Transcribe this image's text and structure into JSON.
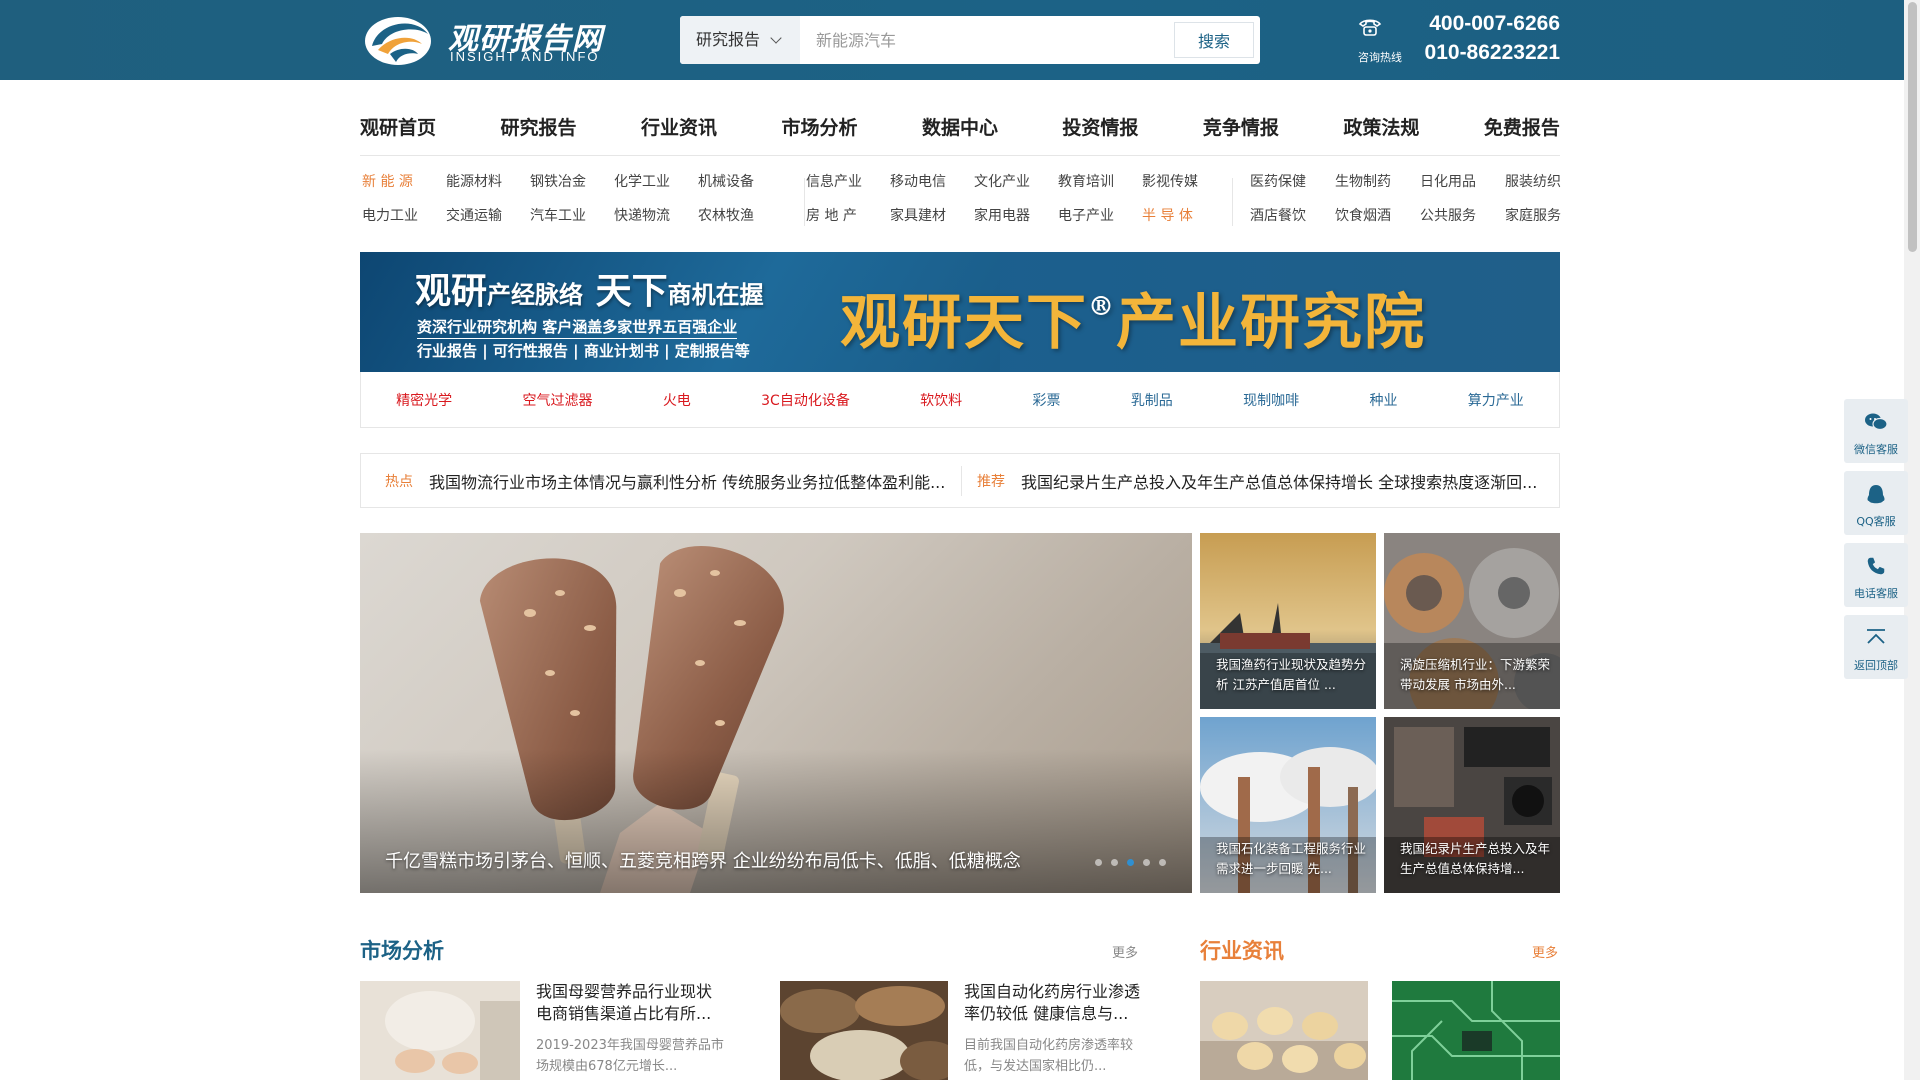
{
  "header": {
    "logo_cn": "观研报告网",
    "logo_en": "INSIGHT AND INFO",
    "search_category": "研究报告",
    "search_placeholder": "新能源汽车",
    "search_button": "搜索",
    "phone1": "400-007-6266",
    "hotline_label": "咨询热线",
    "phone2": "010-86223221"
  },
  "nav": [
    "观研首页",
    "研究报告",
    "行业资讯",
    "市场分析",
    "数据中心",
    "投资情报",
    "竞争情报",
    "政策法规",
    "免费报告"
  ],
  "categories": {
    "group1": [
      "新 能 源",
      "能源材料",
      "钢铁冶金",
      "化学工业",
      "机械设备",
      "电力工业",
      "交通运输",
      "汽车工业",
      "快递物流",
      "农林牧渔"
    ],
    "group2": [
      "信息产业",
      "移动电信",
      "文化产业",
      "教育培训",
      "影视传媒",
      "房 地 产",
      "家具建材",
      "家用电器",
      "电子产业",
      "半 导 体"
    ],
    "group3": [
      "医药保健",
      "生物制药",
      "日化用品",
      "服装纺织",
      "酒店餐饮",
      "饮食烟酒",
      "公共服务",
      "家庭服务"
    ]
  },
  "banner": {
    "brand": "观研",
    "slogan1": "产经脉络",
    "big": "天下",
    "slogan2": "商机在握",
    "line1": "资深行业研究机构 客户涵盖多家世界五百强企业",
    "line2": "行业报告 | 可行性报告 | 商业计划书 | 定制报告等",
    "right_title_a": "观研天下",
    "right_reg": "®",
    "right_title_b": "产业研究院"
  },
  "tags": [
    {
      "label": "精密光学",
      "color": "red"
    },
    {
      "label": "空气过滤器",
      "color": "red"
    },
    {
      "label": "火电",
      "color": "red"
    },
    {
      "label": "3C自动化设备",
      "color": "red"
    },
    {
      "label": "软饮料",
      "color": "red"
    },
    {
      "label": "彩票",
      "color": "blue"
    },
    {
      "label": "乳制品",
      "color": "blue"
    },
    {
      "label": "现制咖啡",
      "color": "blue"
    },
    {
      "label": "种业",
      "color": "blue"
    },
    {
      "label": "算力产业",
      "color": "blue"
    }
  ],
  "ticker": {
    "hot_label": "热点",
    "hot_text": "我国物流行业市场主体情况与赢利性分析 传统服务业务拉低整体盈利能...",
    "rec_label": "推荐",
    "rec_text": "我国纪录片生产总投入及年生产总值总体保持增长 全球搜索热度逐渐回..."
  },
  "hero": {
    "caption": "千亿雪糕市场引茅台、恒顺、五菱竞相跨界 企业纷纷布局低卡、低脂、低糖概念",
    "active_dot": 3,
    "dots": 5
  },
  "thumbs": [
    "我国渔药行业现状及趋势分析 江苏产值居首位 ...",
    "涡旋压缩机行业：下游繁荣带动发展 市场由外...",
    "我国石化装备工程服务行业需求进一步回暖 先...",
    "我国纪录片生产总投入及年生产总值总体保持增..."
  ],
  "market": {
    "title": "市场分析",
    "more": "更多",
    "articles": [
      {
        "title": "我国母婴营养品行业现状 电商销售渠道占比有所...",
        "desc": "2019-2023年我国母婴营养品市场规模由678亿元增长..."
      },
      {
        "title": "我国自动化药房行业渗透率仍较低 健康信息与...",
        "desc": "目前我国自动化药房渗透率较低，与发达国家相比仍..."
      }
    ]
  },
  "industry": {
    "title": "行业资讯",
    "more": "更多"
  },
  "float": [
    "微信客服",
    "QQ客服",
    "电话客服",
    "返回顶部"
  ],
  "colors": {
    "header_bg": "#1c6286",
    "accent_orange": "#e8803a",
    "tag_red": "#d9191f",
    "tag_blue": "#2b6a96",
    "section_blue": "#1c6286"
  }
}
